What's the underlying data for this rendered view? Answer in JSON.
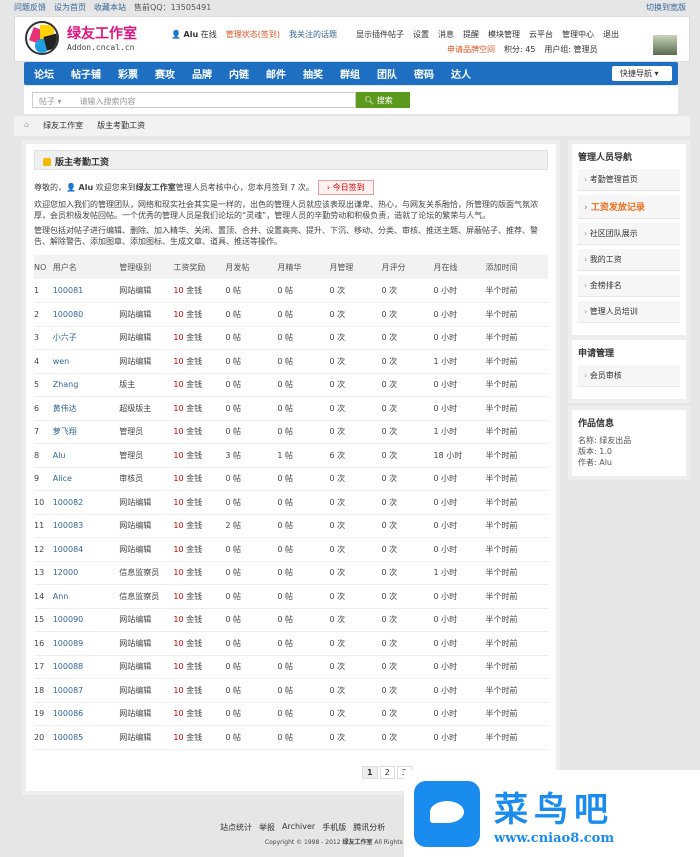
{
  "topbar": {
    "links": [
      "问题反馈",
      "设为首页",
      "收藏本站",
      "售前QQ：13505491"
    ],
    "style_switch": "切换到宽版"
  },
  "header": {
    "brand": "绿友工作室",
    "brand_sub": "Addon.cncal.cn",
    "user": "Alu",
    "online": "在线",
    "status": "管理状态(签到)",
    "menu": [
      "我关注的话题",
      "显示插件帖子",
      "设置",
      "消息",
      "提醒",
      "模块管理",
      "云平台",
      "管理中心",
      "退出"
    ],
    "apply": "申请品牌空间",
    "points": "积分: 45",
    "group": "用户组: 管理员"
  },
  "nav": {
    "items": [
      "论坛",
      "帖子铺",
      "彩票",
      "赛攻",
      "品牌",
      "内链",
      "邮件",
      "抽奖",
      "群组",
      "团队",
      "密码",
      "达人"
    ],
    "quick": "快捷导航"
  },
  "search": {
    "type": "帖子",
    "placeholder": "请输入搜索内容",
    "button": "搜索"
  },
  "breadcrumb": [
    "绿友工作室",
    "版主考勤工资"
  ],
  "main": {
    "title": "版主考勤工资",
    "greeting": "尊敬的，",
    "user": "Alu",
    "greeting2": "欢迎您来到",
    "site": "绿友工作室",
    "greeting3": "管理人员考核中心，您本月签到 7 次。",
    "sign_button": "今日签到",
    "para1": "欢迎您加入我们的管理团队，网络和现实社会其实是一样的，出色的管理人员就应该表现出谦卑、热心，与网友关系融恰，所管理的版面气氛浓厚，会员积极发帖回帖。一个优秀的管理人员是我们论坛的“灵魂”，管理人员的辛勤劳动和积极负责，造就了论坛的繁荣与人气。",
    "para2": "管理包括对帖子进行编辑、删除、加入精华、关闭、置顶、合并、设置高亮、提升、下沉、移动、分类、审核、推送主题、屏蔽帖子、推荐、警告、解除警告、添加图章、添加图标、生成文章、道具、推送等操作。",
    "columns": [
      "NO",
      "用户名",
      "管理级别",
      "工资奖励",
      "月发帖",
      "月精华",
      "月管理",
      "月评分",
      "月在线",
      "添加时间"
    ],
    "rows": [
      [
        "1",
        "100081",
        "网站编辑",
        "10",
        "金钱",
        "0 帖",
        "0 帖",
        "0 次",
        "0 次",
        "0 小时",
        "半个时前"
      ],
      [
        "2",
        "100080",
        "网站编辑",
        "10",
        "金钱",
        "0 帖",
        "0 帖",
        "0 次",
        "0 次",
        "0 小时",
        "半个时前"
      ],
      [
        "3",
        "小六子",
        "网站编辑",
        "10",
        "金钱",
        "0 帖",
        "0 帖",
        "0 次",
        "0 次",
        "0 小时",
        "半个时前"
      ],
      [
        "4",
        "wen",
        "网站编辑",
        "10",
        "金钱",
        "0 帖",
        "0 帖",
        "0 次",
        "0 次",
        "1 小时",
        "半个时前"
      ],
      [
        "5",
        "Zhang",
        "版主",
        "10",
        "金钱",
        "0 帖",
        "0 帖",
        "0 次",
        "0 次",
        "0 小时",
        "半个时前"
      ],
      [
        "6",
        "黄伟达",
        "超级版主",
        "10",
        "金钱",
        "0 帖",
        "0 帖",
        "0 次",
        "0 次",
        "0 小时",
        "半个时前"
      ],
      [
        "7",
        "萝飞翔",
        "管理员",
        "10",
        "金钱",
        "0 帖",
        "0 帖",
        "0 次",
        "0 次",
        "1 小时",
        "半个时前"
      ],
      [
        "8",
        "Alu",
        "管理员",
        "10",
        "金钱",
        "3 帖",
        "1 帖",
        "6 次",
        "0 次",
        "18 小时",
        "半个时前"
      ],
      [
        "9",
        "Alice",
        "审核员",
        "10",
        "金钱",
        "0 帖",
        "0 帖",
        "0 次",
        "0 次",
        "0 小时",
        "半个时前"
      ],
      [
        "10",
        "100082",
        "网站编辑",
        "10",
        "金钱",
        "0 帖",
        "0 帖",
        "0 次",
        "0 次",
        "0 小时",
        "半个时前"
      ],
      [
        "11",
        "100083",
        "网站编辑",
        "10",
        "金钱",
        "2 帖",
        "0 帖",
        "0 次",
        "0 次",
        "0 小时",
        "半个时前"
      ],
      [
        "12",
        "100084",
        "网站编辑",
        "10",
        "金钱",
        "0 帖",
        "0 帖",
        "0 次",
        "0 次",
        "0 小时",
        "半个时前"
      ],
      [
        "13",
        "12000",
        "信息监察员",
        "10",
        "金钱",
        "0 帖",
        "0 帖",
        "0 次",
        "0 次",
        "1 小时",
        "半个时前"
      ],
      [
        "14",
        "Ann",
        "信息监察员",
        "10",
        "金钱",
        "0 帖",
        "0 帖",
        "0 次",
        "0 次",
        "0 小时",
        "半个时前"
      ],
      [
        "15",
        "100090",
        "网站编辑",
        "10",
        "金钱",
        "0 帖",
        "0 帖",
        "0 次",
        "0 次",
        "0 小时",
        "半个时前"
      ],
      [
        "16",
        "100089",
        "网站编辑",
        "10",
        "金钱",
        "0 帖",
        "0 帖",
        "0 次",
        "0 次",
        "0 小时",
        "半个时前"
      ],
      [
        "17",
        "100088",
        "网站编辑",
        "10",
        "金钱",
        "0 帖",
        "0 帖",
        "0 次",
        "0 次",
        "0 小时",
        "半个时前"
      ],
      [
        "18",
        "100087",
        "网站编辑",
        "10",
        "金钱",
        "0 帖",
        "0 帖",
        "0 次",
        "0 次",
        "0 小时",
        "半个时前"
      ],
      [
        "19",
        "100086",
        "网站编辑",
        "10",
        "金钱",
        "0 帖",
        "0 帖",
        "0 次",
        "0 次",
        "0 小时",
        "半个时前"
      ],
      [
        "20",
        "100085",
        "网站编辑",
        "10",
        "金钱",
        "0 帖",
        "0 帖",
        "0 次",
        "0 次",
        "0 小时",
        "半个时前"
      ]
    ],
    "pages": [
      "1",
      "2",
      "3"
    ]
  },
  "sidebar": {
    "nav_title": "管理人员导航",
    "nav": [
      "考勤管理首页",
      "工资发放记录",
      "社区团队展示",
      "我的工资",
      "金榜排名",
      "管理人员培训"
    ],
    "apply_title": "申请管理",
    "apply": [
      "会员审核"
    ],
    "info_title": "作品信息",
    "info": [
      "名称: 绿友出品",
      "版本: 1.0",
      "作者: Alu"
    ]
  },
  "footer": {
    "links": [
      "站点统计",
      "举报",
      "Archiver",
      "手机版",
      "腾讯分析"
    ],
    "copy_pre": "Copyright © 1998 - 2012",
    "copy_site": "绿友工作室",
    "copy_post": "All Rights Reserved. Powered by Discuz!"
  },
  "watermark": {
    "cn": "菜鸟吧",
    "url": "www.cniao8.com"
  }
}
